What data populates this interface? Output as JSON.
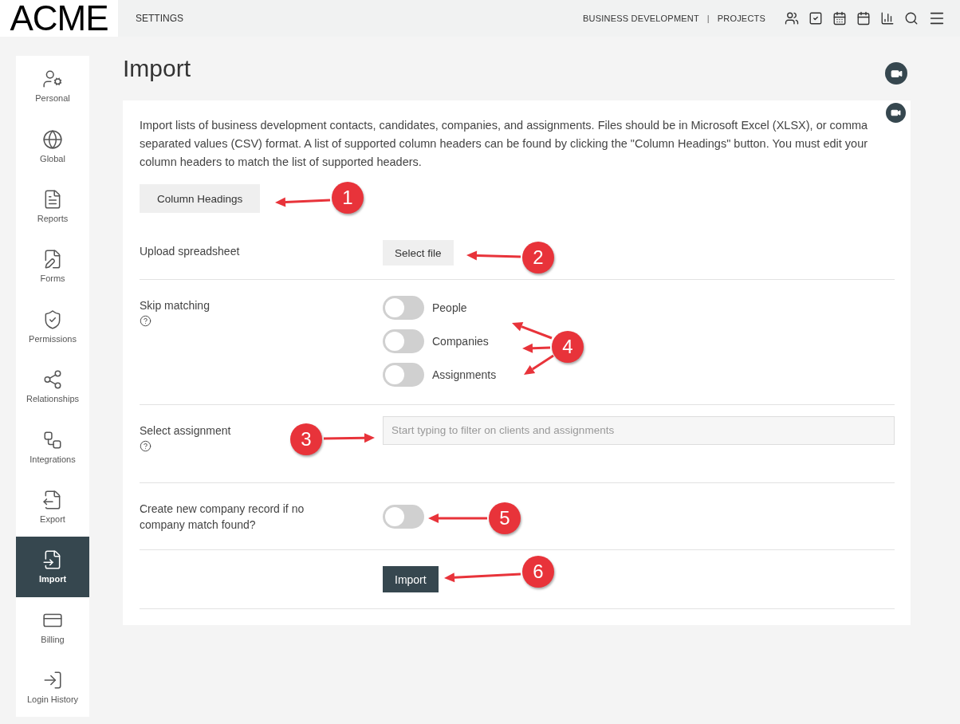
{
  "header": {
    "logo": "ACME",
    "section": "SETTINGS",
    "nav_links": [
      "BUSINESS DEVELOPMENT",
      "PROJECTS"
    ],
    "separator": "|"
  },
  "sidebar": {
    "items": [
      {
        "label": "Personal",
        "selected": false
      },
      {
        "label": "Global",
        "selected": false
      },
      {
        "label": "Reports",
        "selected": false
      },
      {
        "label": "Forms",
        "selected": false
      },
      {
        "label": "Permissions",
        "selected": false
      },
      {
        "label": "Relationships",
        "selected": false
      },
      {
        "label": "Integrations",
        "selected": false
      },
      {
        "label": "Export",
        "selected": false
      },
      {
        "label": "Import",
        "selected": true
      },
      {
        "label": "Billing",
        "selected": false
      },
      {
        "label": "Login History",
        "selected": false
      }
    ]
  },
  "page": {
    "title": "Import"
  },
  "form": {
    "description": "Import lists of business development contacts, candidates, companies, and assignments. Files should be in Microsoft Excel (XLSX), or comma separated values (CSV) format. A list of supported column headers can be found by clicking the \"Column Headings\" button. You must edit your column headers to match the list of supported headers.",
    "column_headings_button": "Column Headings",
    "upload": {
      "label": "Upload spreadsheet",
      "button": "Select file"
    },
    "skip_matching": {
      "label": "Skip matching",
      "toggles": [
        {
          "label": "People",
          "on": false
        },
        {
          "label": "Companies",
          "on": false
        },
        {
          "label": "Assignments",
          "on": false
        }
      ]
    },
    "select_assignment": {
      "label": "Select assignment",
      "placeholder": "Start typing to filter on clients and assignments"
    },
    "create_company": {
      "label": "Create new company record if no company match found?",
      "on": false
    },
    "import_button": "Import"
  },
  "annotations": [
    {
      "number": "1"
    },
    {
      "number": "2"
    },
    {
      "number": "3"
    },
    {
      "number": "4"
    },
    {
      "number": "5"
    },
    {
      "number": "6"
    }
  ]
}
